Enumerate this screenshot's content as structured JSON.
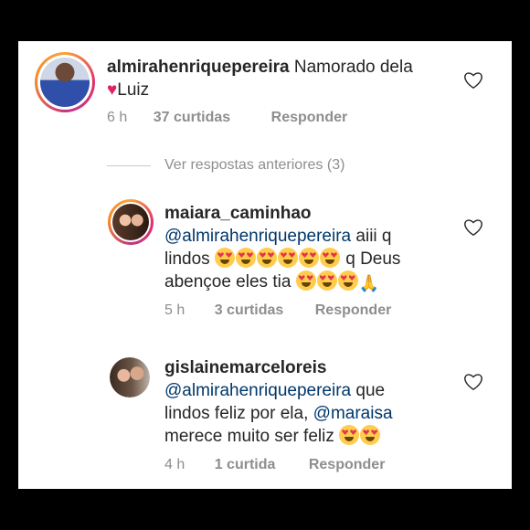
{
  "comments": [
    {
      "username": "almirahenriquepereira",
      "text": "Namorado dela",
      "line2_heart": "♥",
      "line2_text": "Luiz",
      "time": "6 h",
      "likes": "37 curtidas",
      "reply": "Responder"
    },
    {
      "username": "maiara_caminhao",
      "mention": "@almirahenriquepereira",
      "text1": "aiii q",
      "text2": "lindos",
      "text3": "q Deus",
      "text4": "abençoe eles tia",
      "time": "5 h",
      "likes": "3 curtidas",
      "reply": "Responder"
    },
    {
      "username": "gislainemarceloreis",
      "mention": "@almirahenriquepereira",
      "text1": "que",
      "text2": "lindos feliz por ela,",
      "mention2": "@maraisa",
      "text3": "merece muito ser feliz",
      "time": "4 h",
      "likes": "1 curtida",
      "reply": "Responder"
    }
  ],
  "view_replies": "Ver respostas anteriores (3)",
  "icons": {
    "like": "heart-outline-icon",
    "emoji_heart_eyes": "heart-eyes-emoji",
    "emoji_pray": "praying-hands-emoji"
  }
}
